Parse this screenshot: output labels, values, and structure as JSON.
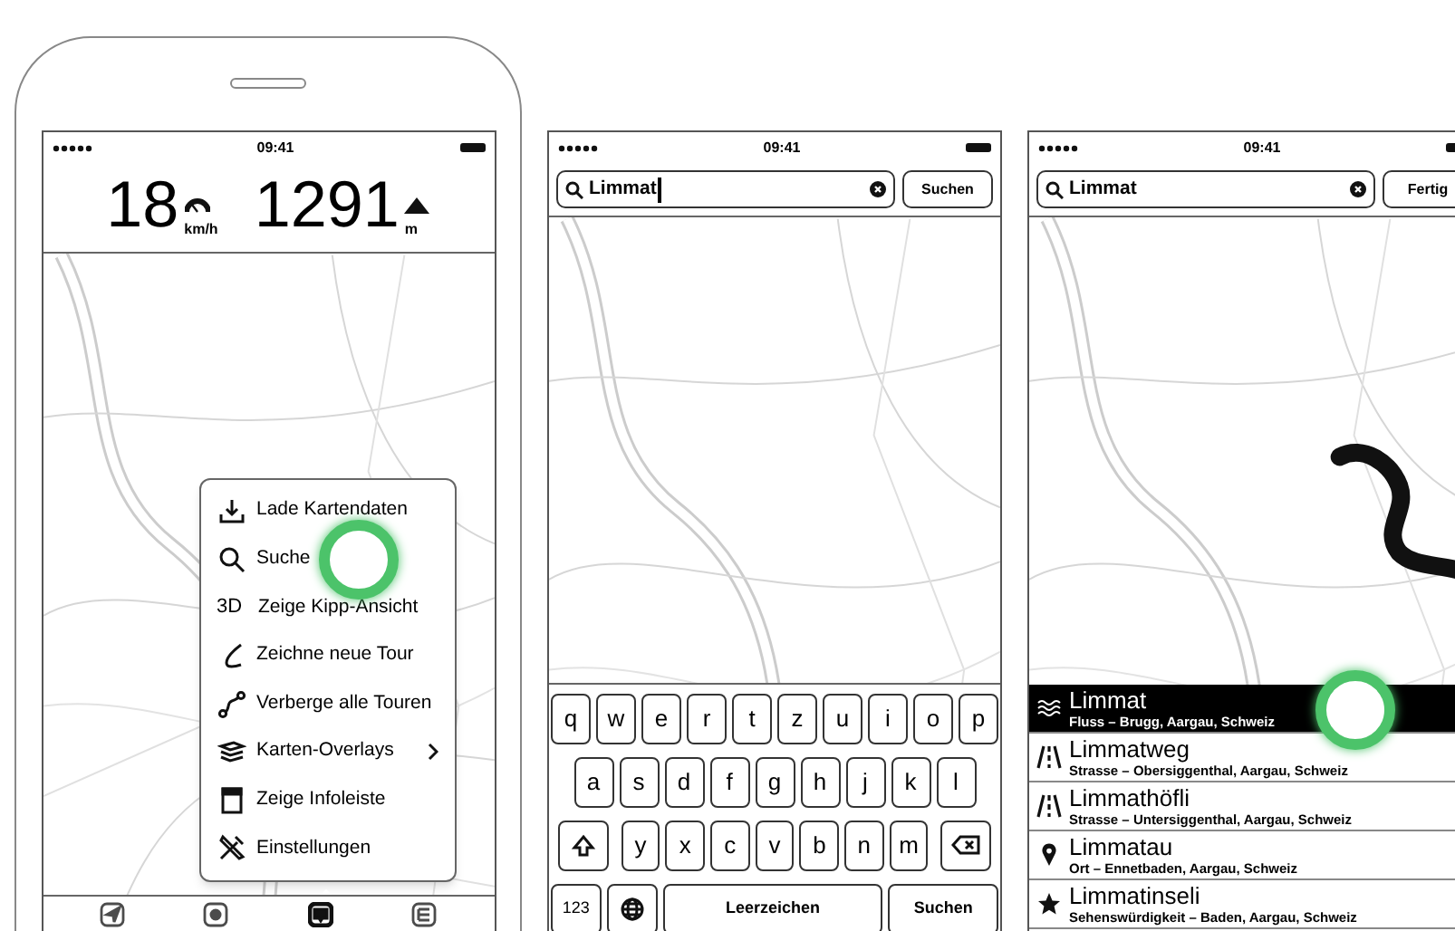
{
  "screens": [
    {
      "kind": "menu",
      "status": {
        "time": "09:41"
      },
      "stats": [
        {
          "value": "18",
          "unit": "km/h"
        },
        {
          "value": "1291",
          "unit": "m"
        }
      ],
      "menu": [
        {
          "label": "Lade Kartendaten",
          "tapped": false
        },
        {
          "label": "Suche",
          "tapped": true
        },
        {
          "label": "Zeige Kipp-Ansicht",
          "badge": "3D",
          "tapped": false
        },
        {
          "label": "Zeichne neue Tour",
          "tapped": false
        },
        {
          "label": "Verberge alle Touren",
          "tapped": false
        },
        {
          "label": "Karten-Overlays",
          "submenu": true,
          "tapped": false
        },
        {
          "label": "Zeige Infoleiste",
          "tapped": false
        },
        {
          "label": "Einstellungen",
          "tapped": false
        }
      ],
      "tab_bar": [
        {
          "selected": false
        },
        {
          "selected": false
        },
        {
          "selected": true
        },
        {
          "selected": false
        }
      ]
    },
    {
      "kind": "keyboard",
      "status": {
        "time": "09:41"
      },
      "search": {
        "value": "Limmat",
        "focused": true
      },
      "button": "Suchen",
      "keyboard": [
        [
          {
            "label": "q"
          },
          {
            "label": "w"
          },
          {
            "label": "e"
          },
          {
            "label": "r"
          },
          {
            "label": "t"
          },
          {
            "label": "z"
          },
          {
            "label": "u"
          },
          {
            "label": "i"
          },
          {
            "label": "o"
          },
          {
            "label": "p"
          }
        ],
        [
          {
            "label": "a"
          },
          {
            "label": "s"
          },
          {
            "label": "d"
          },
          {
            "label": "f"
          },
          {
            "label": "g"
          },
          {
            "label": "h"
          },
          {
            "label": "j"
          },
          {
            "label": "k"
          },
          {
            "label": "l"
          }
        ],
        [
          {
            "kind": "shift"
          },
          {
            "label": "y"
          },
          {
            "label": "x"
          },
          {
            "label": "c"
          },
          {
            "label": "v"
          },
          {
            "label": "b"
          },
          {
            "label": "n"
          },
          {
            "label": "m"
          },
          {
            "kind": "backspace"
          }
        ],
        [
          {
            "kind": "mode",
            "label": "123"
          },
          {
            "kind": "globe"
          },
          {
            "kind": "space",
            "label": "Leerzeichen"
          },
          {
            "kind": "return",
            "label": "Suchen"
          }
        ]
      ]
    },
    {
      "kind": "results",
      "status": {
        "time": "09:41"
      },
      "search": {
        "value": "Limmat",
        "focused": false
      },
      "button": "Fertig",
      "route_shown": true,
      "results": [
        {
          "title": "Limmat",
          "subtitle": "Fluss – Brugg, Aargau, Schweiz",
          "selected": true,
          "tapped": true
        },
        {
          "title": "Limmatweg",
          "subtitle": "Strasse – Obersiggenthal, Aargau, Schweiz",
          "selected": false,
          "tapped": false
        },
        {
          "title": "Limmathöfli",
          "subtitle": "Strasse – Untersiggenthal, Aargau, Schweiz",
          "selected": false,
          "tapped": false
        },
        {
          "title": "Limmatau",
          "subtitle": "Ort – Ennetbaden, Aargau, Schweiz",
          "selected": false,
          "tapped": false
        },
        {
          "title": "Limmatinseli",
          "subtitle": "Sehenswürdigkeit – Baden, Aargau, Schweiz",
          "selected": false,
          "tapped": false
        }
      ]
    }
  ]
}
